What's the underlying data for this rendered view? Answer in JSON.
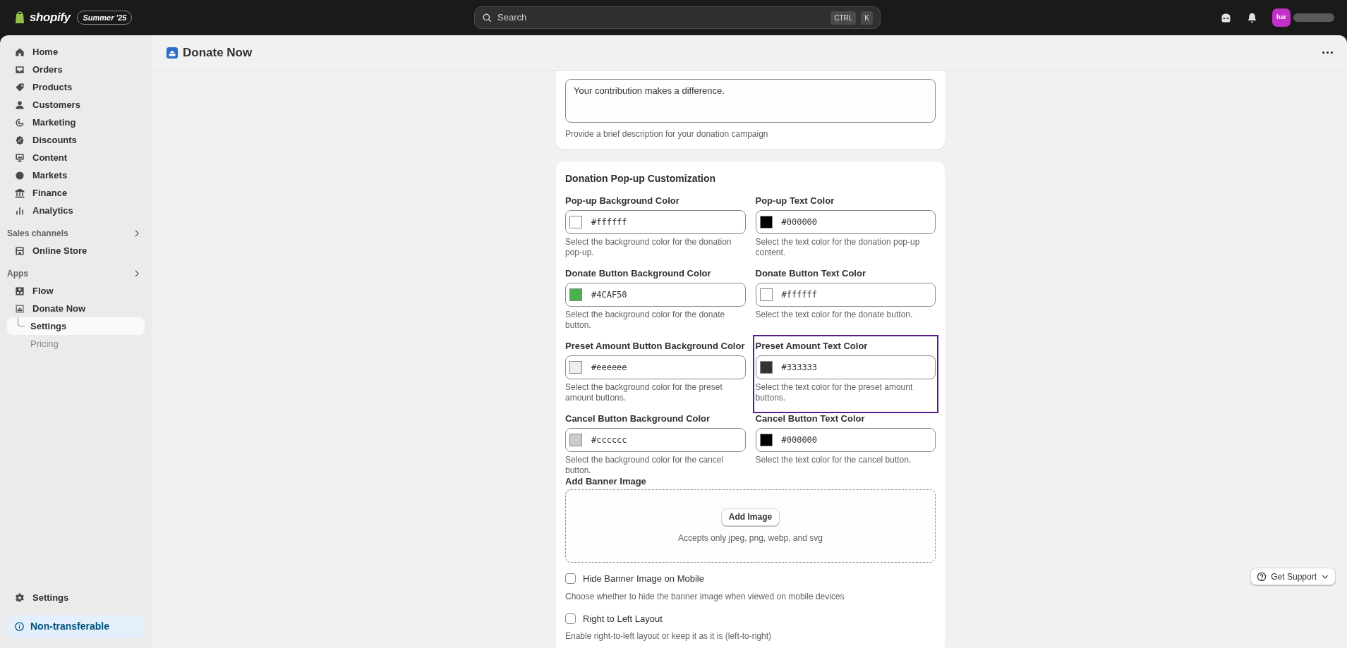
{
  "topbar": {
    "brand": "shopify",
    "edition": "Summer '25",
    "search": {
      "placeholder": "Search"
    },
    "shortcut": [
      "CTRL",
      "K"
    ],
    "avatar": "har"
  },
  "sidebar": {
    "items": [
      {
        "label": "Home",
        "selected": false
      },
      {
        "label": "Orders",
        "selected": false
      },
      {
        "label": "Products",
        "selected": false
      },
      {
        "label": "Customers",
        "selected": false
      },
      {
        "label": "Marketing",
        "selected": false
      },
      {
        "label": "Discounts",
        "selected": false
      },
      {
        "label": "Content",
        "selected": false
      },
      {
        "label": "Markets",
        "selected": false
      },
      {
        "label": "Finance",
        "selected": false
      },
      {
        "label": "Analytics",
        "selected": false
      }
    ],
    "sections": [
      {
        "title": "Sales channels",
        "items": [
          {
            "label": "Online Store",
            "selected": false
          }
        ]
      },
      {
        "title": "Apps",
        "items": [
          {
            "label": "Flow",
            "selected": false
          },
          {
            "label": "Donate Now",
            "selected": false,
            "children": [
              {
                "label": "Settings",
                "selected": true
              },
              {
                "label": "Pricing",
                "selected": false
              }
            ]
          }
        ]
      }
    ],
    "settings": "Settings",
    "badge": "Non-transferable"
  },
  "page": {
    "title": "Donate Now"
  },
  "description": {
    "value": "Your contribution makes a difference.",
    "help": "Provide a brief description for your donation campaign"
  },
  "customization": {
    "title": "Donation Pop-up Customization",
    "fields": [
      {
        "label": "Pop-up Background Color",
        "value": "#ffffff",
        "color": "#ffffff",
        "help": "Select the background color for the donation pop-up.",
        "focused": false
      },
      {
        "label": "Pop-up Text Color",
        "value": "#000000",
        "color": "#000000",
        "help": "Select the text color for the donation pop-up content.",
        "focused": false
      },
      {
        "label": "Donate Button Background Color",
        "value": "#4CAF50",
        "color": "#4caf50",
        "help": "Select the background color for the donate button.",
        "focused": false
      },
      {
        "label": "Donate Button Text Color",
        "value": "#ffffff",
        "color": "#ffffff",
        "help": "Select the text color for the donate button.",
        "focused": false
      },
      {
        "label": "Preset Amount Button Background Color",
        "value": "#eeeeee",
        "color": "#eeeeee",
        "help": "Select the background color for the preset amount buttons.",
        "focused": false
      },
      {
        "label": "Preset Amount Text Color",
        "value": "#333333",
        "color": "#333333",
        "help": "Select the text color for the preset amount buttons.",
        "focused": true
      },
      {
        "label": "Cancel Button Background Color",
        "value": "#cccccc",
        "color": "#cccccc",
        "help": "Select the background color for the cancel button.",
        "focused": false
      },
      {
        "label": "Cancel Button Text Color",
        "value": "#000000",
        "color": "#000000",
        "help": "Select the text color for the cancel button.",
        "focused": false
      }
    ],
    "banner": {
      "label": "Add Banner Image",
      "button": "Add Image",
      "note": "Accepts only jpeg, png, webp, and svg"
    },
    "options": [
      {
        "label": "Hide Banner Image on Mobile",
        "checked": false,
        "help": "Choose whether to hide the banner image when viewed on mobile devices"
      },
      {
        "label": "Right to Left Layout",
        "checked": false,
        "help": "Enable right-to-left layout or keep it as it is (left-to-right)"
      }
    ]
  },
  "support": {
    "label": "Get Support"
  }
}
